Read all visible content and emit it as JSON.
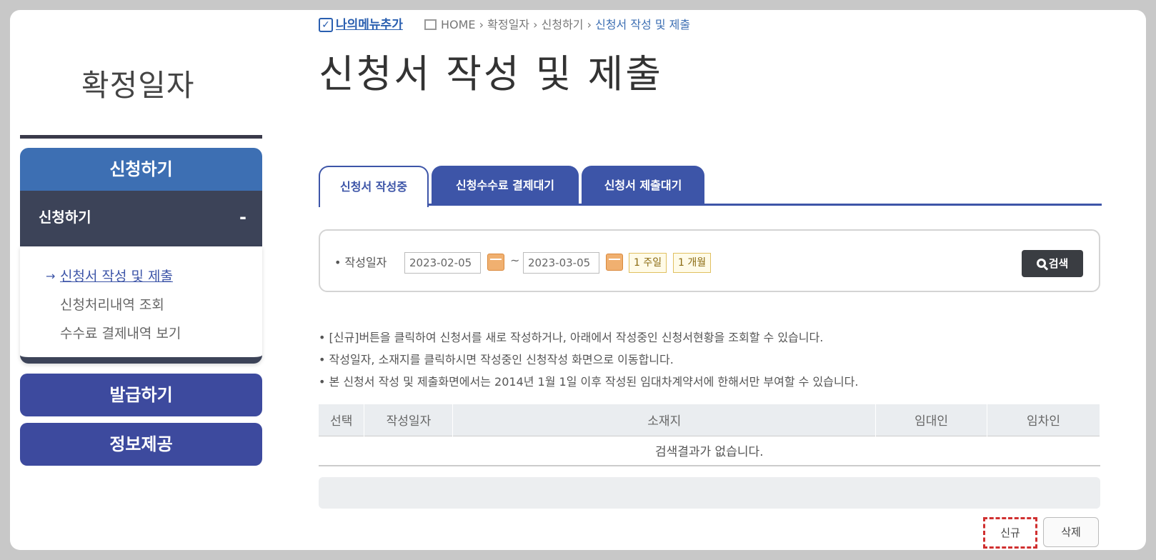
{
  "sidebar": {
    "title": "확정일자",
    "main_menu": "신청하기",
    "sub_menu": "신청하기",
    "sub_toggle": "-",
    "items": [
      {
        "label": "신청서 작성 및 제출"
      },
      {
        "label": "신청처리내역 조회"
      },
      {
        "label": "수수료 결제내역 보기"
      }
    ],
    "active_arrow": "→",
    "issue_button": "발급하기",
    "info_button": "정보제공"
  },
  "header": {
    "my_menu": "나의메뉴추가",
    "my_menu_check": "✓",
    "breadcrumb": [
      "HOME",
      "확정일자",
      "신청하기",
      "신청서 작성 및 제출"
    ],
    "separator": "›",
    "title": "신청서 작성 및 제출"
  },
  "tabs": [
    {
      "label": "신청서 작성중"
    },
    {
      "label": "신청수수료 결제대기"
    },
    {
      "label": "신청서 제출대기"
    }
  ],
  "search": {
    "label": "• 작성일자",
    "date_from": "2023-02-05",
    "date_to": "2023-03-05",
    "tilde": "~",
    "week_button": "1 주일",
    "month_button": "1 개월",
    "search_button": "검색"
  },
  "notes": [
    "• [신규]버튼을 클릭하여 신청서를 새로 작성하거나, 아래에서 작성중인 신청서현황을 조회할 수 있습니다.",
    "• 작성일자, 소재지를 클릭하시면 작성중인 신청작성 화면으로 이동합니다.",
    "• 본 신청서 작성 및 제출화면에서는 2014년 1월 1일 이후 작성된 임대차계약서에 한해서만 부여할 수 있습니다."
  ],
  "table": {
    "headers": [
      "선택",
      "작성일자",
      "소재지",
      "임대인",
      "임차인"
    ],
    "empty": "검색결과가 없습니다."
  },
  "buttons": {
    "new": "신규",
    "delete": "삭제"
  }
}
